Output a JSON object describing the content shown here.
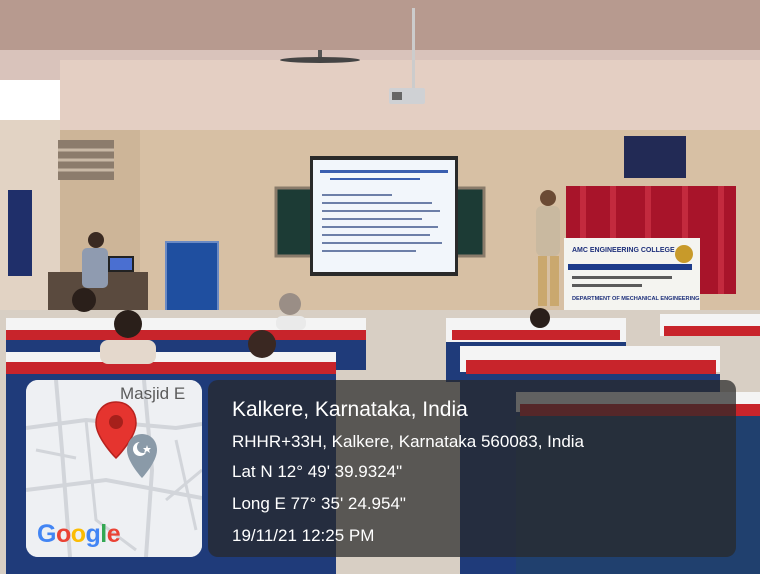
{
  "stamp": {
    "place": "Kalkere, Karnataka, India",
    "address": "RHHR+33H, Kalkere, Karnataka 560083, India",
    "lat": "Lat N 12° 49' 39.9324\"",
    "long": "Long E 77° 35' 24.954\"",
    "datetime": "19/11/21 12:25 PM"
  },
  "map": {
    "place_label": "Masjid E",
    "brand": [
      "G",
      "o",
      "o",
      "g",
      "l",
      "e"
    ],
    "brand_colors": [
      "#4285F4",
      "#EA4335",
      "#FBBC05",
      "#4285F4",
      "#34A853",
      "#EA4335"
    ]
  },
  "banner": {
    "title": "AMC ENGINEERING COLLEGE",
    "dept": "DEPARTMENT OF MECHANICAL ENGINEERING"
  },
  "colors": {
    "desk_red": "#c8242b",
    "desk_blue": "#1f3b7a",
    "curtain": "#b0122a",
    "wall": "#d8c3a8"
  }
}
